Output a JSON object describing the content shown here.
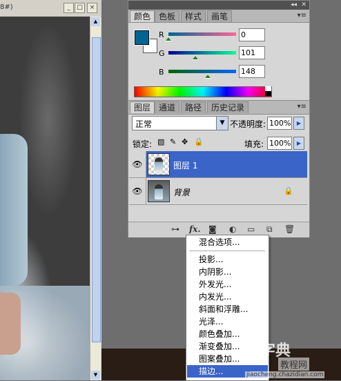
{
  "document": {
    "title_fragment": "8#)",
    "controls": [
      "_",
      "□",
      "×"
    ]
  },
  "color_panel": {
    "tabs": [
      "颜色",
      "色板",
      "样式",
      "画笔"
    ],
    "foreground_color": "#006594",
    "background_color": "#ffffff",
    "channels": [
      {
        "label": "R",
        "value": "0",
        "slider_level": 0.0
      },
      {
        "label": "G",
        "value": "101",
        "slider_level": 0.396
      },
      {
        "label": "B",
        "value": "148",
        "slider_level": 0.58
      }
    ]
  },
  "layers_panel": {
    "tabs": [
      "图层",
      "通道",
      "路径",
      "历史记录"
    ],
    "blend_mode": "正常",
    "opacity_label": "不透明度:",
    "opacity_value": "100%",
    "lock_label": "锁定:",
    "fill_label": "填充:",
    "fill_value": "100%",
    "layers": [
      {
        "name": "图层 1",
        "selected": true
      },
      {
        "name": "背景",
        "selected": false,
        "locked": true
      }
    ],
    "footer_icons": [
      "link-icon",
      "fx-icon",
      "mask-icon",
      "adjustment-icon",
      "folder-icon",
      "new-layer-icon",
      "trash-icon"
    ],
    "fx_label": "fx."
  },
  "fx_menu": {
    "items": [
      "混合选项...",
      "投影...",
      "内阴影...",
      "外发光...",
      "内发光...",
      "斜面和浮雕...",
      "光泽...",
      "颜色叠加...",
      "渐变叠加...",
      "图案叠加...",
      "描边..."
    ],
    "selected_index": 10
  },
  "watermark": {
    "line1": "查字典",
    "line2": "教程网",
    "line3": "jiaocheng.chazidian.com"
  }
}
